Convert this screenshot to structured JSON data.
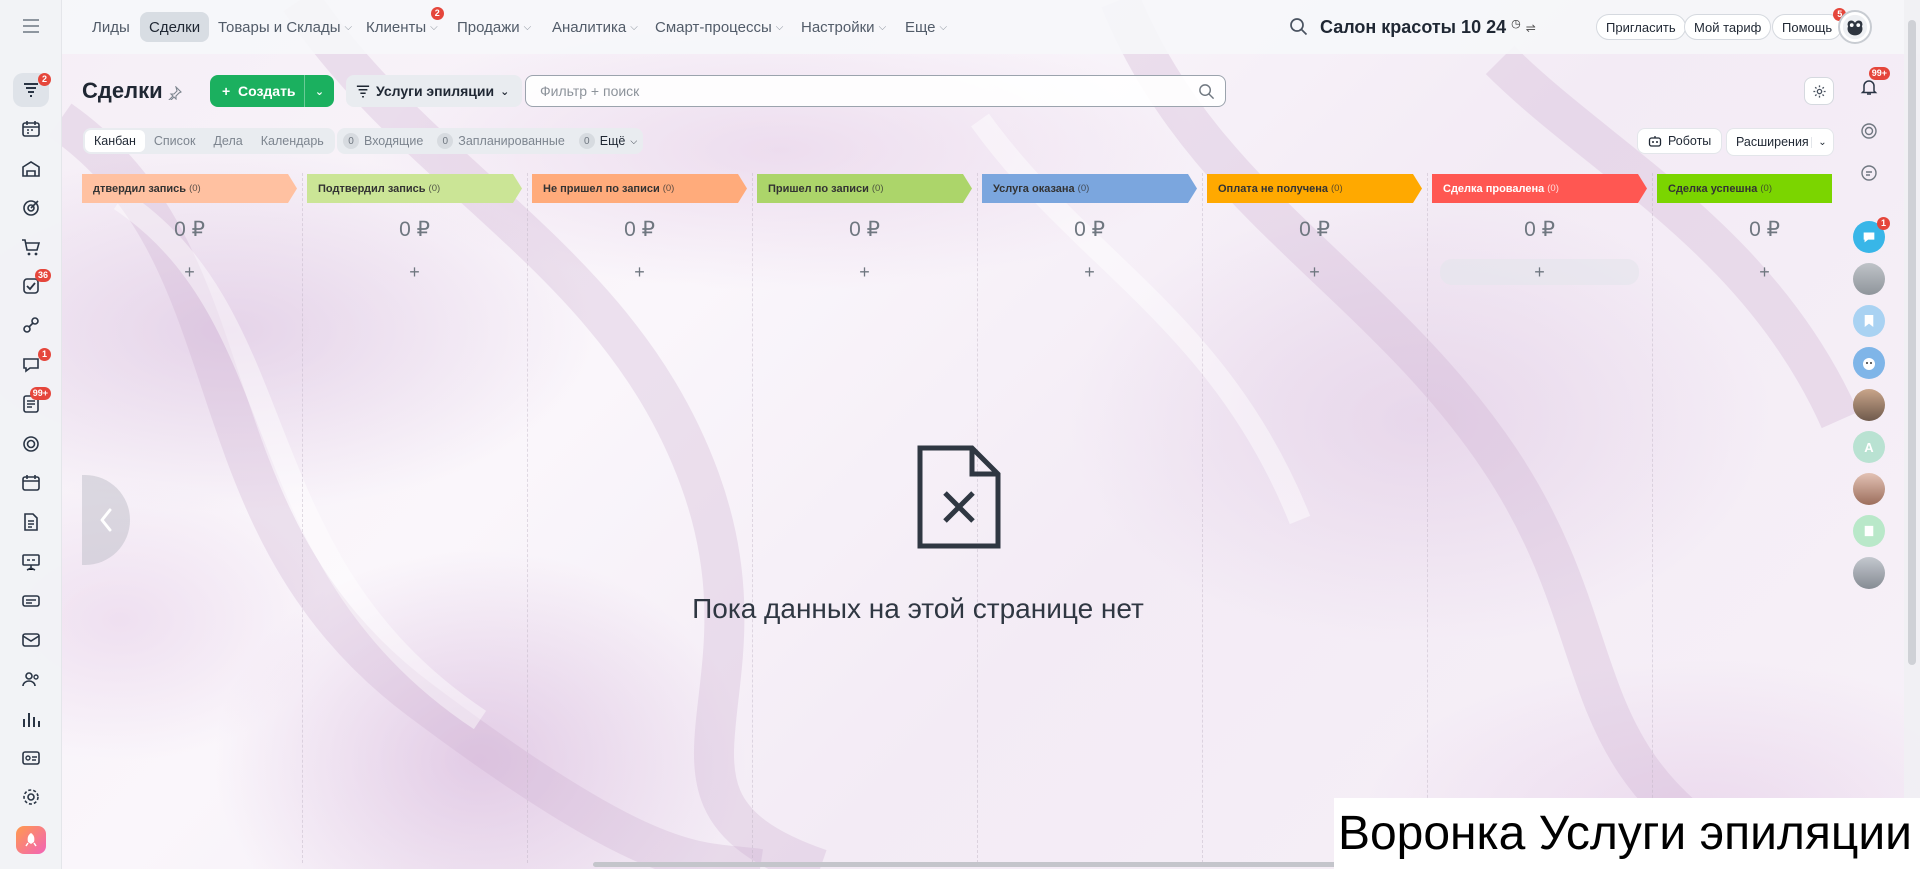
{
  "topnav": {
    "items": [
      {
        "label": "Лиды",
        "chevron": false
      },
      {
        "label": "Сделки",
        "chevron": false,
        "active": true
      },
      {
        "label": "Товары и Склады",
        "chevron": true
      },
      {
        "label": "Клиенты",
        "chevron": true,
        "badge": "2"
      },
      {
        "label": "Продажи",
        "chevron": true
      },
      {
        "label": "Аналитика",
        "chevron": true
      },
      {
        "label": "Смарт-процессы",
        "chevron": true
      },
      {
        "label": "Настройки",
        "chevron": true
      },
      {
        "label": "Еще",
        "chevron": true
      }
    ],
    "company": "Салон красоты 10 24",
    "invite": "Пригласить",
    "tariff": "Мой тариф",
    "help": "Помощь",
    "help_badge": "5"
  },
  "leftbar": {
    "items": [
      {
        "icon": "crm-funnel-icon",
        "badge": "2",
        "active": true
      },
      {
        "icon": "calendar-grid-icon"
      },
      {
        "icon": "warehouse-icon"
      },
      {
        "icon": "target-icon"
      },
      {
        "icon": "cart-icon"
      },
      {
        "icon": "tasks-icon",
        "badge": "36"
      },
      {
        "icon": "automation-icon"
      },
      {
        "icon": "chat-icon",
        "badge": "1"
      },
      {
        "icon": "feed-icon",
        "badge": "99+"
      },
      {
        "icon": "sites-icon"
      },
      {
        "icon": "calendar-icon"
      },
      {
        "icon": "documents-icon"
      },
      {
        "icon": "presentation-icon"
      },
      {
        "icon": "terminal-icon"
      },
      {
        "icon": "mail-icon"
      },
      {
        "icon": "contacts-icon"
      },
      {
        "icon": "reports-icon"
      },
      {
        "icon": "id-card-icon"
      },
      {
        "icon": "settings-icon"
      },
      {
        "icon": "rocket-icon"
      }
    ]
  },
  "page": {
    "title": "Сделки",
    "create_label": "Создать",
    "pipeline_label": "Услуги эпиляции",
    "filter_placeholder": "Фильтр + поиск"
  },
  "views": {
    "tabs": [
      "Канбан",
      "Список",
      "Дела",
      "Календарь"
    ],
    "active_tab": "Канбан",
    "counters": [
      {
        "count": "0",
        "label": "Входящие"
      },
      {
        "count": "0",
        "label": "Запланированные"
      },
      {
        "count": "0",
        "label": "Ещё"
      }
    ],
    "robots": "Роботы",
    "extensions": "Расширения"
  },
  "kanban": {
    "columns": [
      {
        "title": "дтвердил запись",
        "count": "(0)",
        "sum": "0 ₽",
        "color": "#ffc1a1",
        "text": "light"
      },
      {
        "title": "Подтвердил запись",
        "count": "(0)",
        "sum": "0 ₽",
        "color": "#cbe596",
        "text": "light"
      },
      {
        "title": "Не пришел по записи",
        "count": "(0)",
        "sum": "0 ₽",
        "color": "#ffab7b",
        "text": "light"
      },
      {
        "title": "Пришел по записи",
        "count": "(0)",
        "sum": "0 ₽",
        "color": "#acd56a",
        "text": "light"
      },
      {
        "title": "Услуга оказана",
        "count": "(0)",
        "sum": "0 ₽",
        "color": "#7ba6de",
        "text": "light"
      },
      {
        "title": "Оплата не получена",
        "count": "(0)",
        "sum": "0 ₽",
        "color": "#ffa900",
        "text": "light"
      },
      {
        "title": "Сделка провалена",
        "count": "(0)",
        "sum": "0 ₽",
        "color": "#ff5752",
        "text": "dark"
      },
      {
        "title": "Сделка успешна",
        "count": "(0)",
        "sum": "0 ₽",
        "color": "#7bd500",
        "text": "light"
      }
    ],
    "add_symbol": "+"
  },
  "empty_state": {
    "text": "Пока данных на этой странице нет"
  },
  "rightbar": {
    "notifications_badge": "99+",
    "chat_badge": "1",
    "avatar_letter": "A"
  },
  "caption": "Воронка Услуги эпиляции"
}
